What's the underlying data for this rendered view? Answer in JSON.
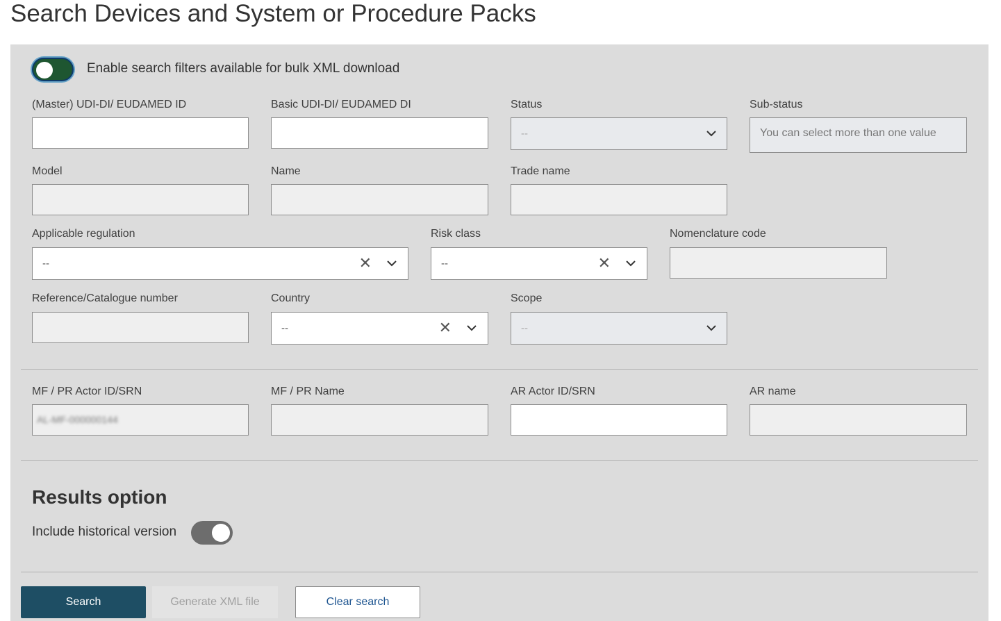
{
  "page": {
    "title": "Search Devices and System or Procedure Packs"
  },
  "bulk_toggle": {
    "label": "Enable search filters available for bulk XML download",
    "state": "on"
  },
  "fields": {
    "master_udi": {
      "label": "(Master) UDI-DI/ EUDAMED ID",
      "value": ""
    },
    "basic_udi": {
      "label": "Basic UDI-DI/ EUDAMED DI",
      "value": ""
    },
    "status": {
      "label": "Status",
      "value": "--"
    },
    "sub_status": {
      "label": "Sub-status",
      "placeholder": "You can select more than one value"
    },
    "model": {
      "label": "Model",
      "value": ""
    },
    "name": {
      "label": "Name",
      "value": ""
    },
    "trade_name": {
      "label": "Trade name",
      "value": ""
    },
    "applicable_regulation": {
      "label": "Applicable regulation",
      "value": "--"
    },
    "risk_class": {
      "label": "Risk class",
      "value": "--"
    },
    "nomenclature_code": {
      "label": "Nomenclature code",
      "value": ""
    },
    "reference_number": {
      "label": "Reference/Catalogue number",
      "value": ""
    },
    "country": {
      "label": "Country",
      "value": "--"
    },
    "scope": {
      "label": "Scope",
      "value": "--"
    },
    "mf_pr_actor_id": {
      "label": "MF / PR Actor ID/SRN",
      "value": "AL-MF-000000144"
    },
    "mf_pr_name": {
      "label": "MF / PR Name",
      "value": ""
    },
    "ar_actor_id": {
      "label": "AR Actor ID/SRN",
      "value": ""
    },
    "ar_name": {
      "label": "AR name",
      "value": ""
    }
  },
  "results": {
    "title": "Results option",
    "historical_label": "Include historical version",
    "historical_state": "on"
  },
  "buttons": {
    "search": "Search",
    "generate_xml": "Generate XML file",
    "clear_search": "Clear search"
  },
  "colors": {
    "panel_bg": "#dcdcdc",
    "primary": "#1e4e64",
    "toggle_on": "#1e5631",
    "toggle_off": "#6d6d6d",
    "link_blue": "#1e5590"
  },
  "icons": {
    "clear": "close-icon",
    "dropdown": "chevron-down-icon"
  }
}
